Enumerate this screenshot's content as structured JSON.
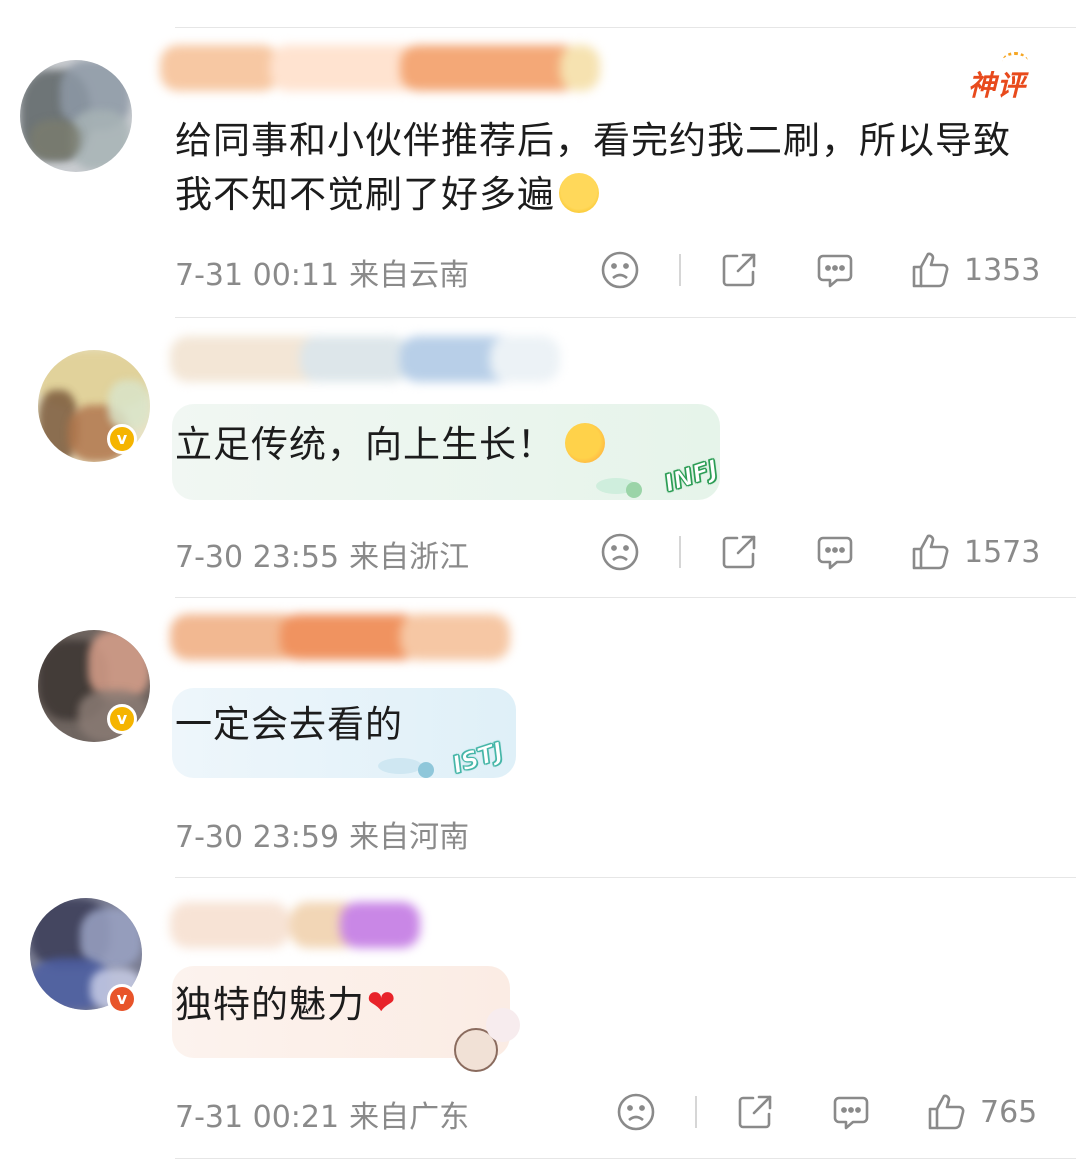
{
  "comments": [
    {
      "text": "给同事和小伙伴推荐后，看完约我二刷，所以导致我不知不觉刷了好多遍",
      "emoji": "crying-face-emoji",
      "badge": "神评",
      "time": "7-31 00:11",
      "location": "来自云南",
      "likes": "1353",
      "verified": false
    },
    {
      "text": "立足传统，向上生长！",
      "emoji": "sparkle-flower-face-emoji",
      "mbti": "INFJ",
      "time": "7-30 23:55",
      "location": "来自浙江",
      "likes": "1573",
      "verified": true
    },
    {
      "text": "一定会去看的",
      "mbti": "ISTJ",
      "time": "7-30 23:59",
      "location": "来自河南",
      "verified": true
    },
    {
      "text": "独特的魅力",
      "emoji": "red-heart",
      "heart": "❤",
      "time": "7-31 00:21",
      "location": "来自广东",
      "likes": "765",
      "verified": true
    }
  ],
  "icons": {
    "dislike": "sad-face-icon",
    "share": "share-icon",
    "reply": "comment-bubble-icon",
    "like": "thumbs-up-icon"
  },
  "colors": {
    "meta_text": "#8a8a8a",
    "hot_badge": "#e84a1c",
    "verified_gold": "#f5b400",
    "verified_red": "#e8542a",
    "heart": "#e8232a"
  }
}
